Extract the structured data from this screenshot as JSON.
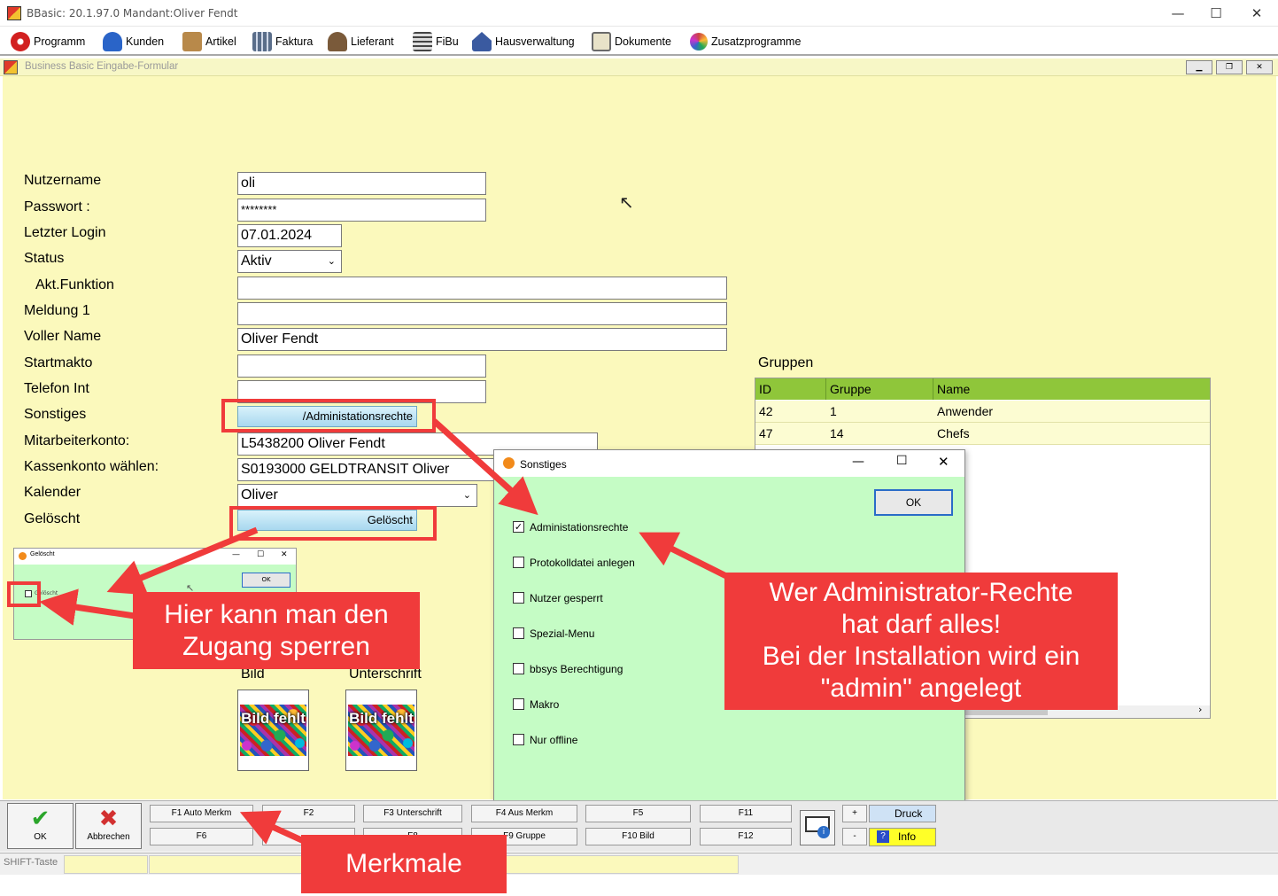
{
  "window": {
    "title": "BBasic: 20.1.97.0 Mandant:Oliver Fendt",
    "min": "—",
    "max": "☐",
    "close": "✕"
  },
  "menubar": {
    "items": [
      {
        "label": "Programm",
        "icon": "program-icon",
        "color": "#d22020"
      },
      {
        "label": "Kunden",
        "icon": "customer-icon",
        "color": "#2a64c8"
      },
      {
        "label": "Artikel",
        "icon": "article-icon",
        "color": "#b8894a"
      },
      {
        "label": "Faktura",
        "icon": "invoice-icon",
        "color": "#5a6e8a"
      },
      {
        "label": "Lieferant",
        "icon": "supplier-icon",
        "color": "#7a5a3a"
      },
      {
        "label": "FiBu",
        "icon": "accounting-icon",
        "color": "#444444"
      },
      {
        "label": "Hausverwaltung",
        "icon": "house-icon",
        "color": "#3a5aa0"
      },
      {
        "label": "Dokumente",
        "icon": "documents-icon",
        "color": "#6a6a6a"
      },
      {
        "label": "Zusatzprogramme",
        "icon": "addon-icon",
        "color": "#c44"
      }
    ]
  },
  "form": {
    "title": "Business Basic Eingabe-Formular",
    "labels": {
      "nutzername": "Nutzername",
      "passwort": "Passwort :",
      "letzter_login": "Letzter Login",
      "status": "Status",
      "akt_funktion": "Akt.Funktion",
      "meldung": "Meldung 1",
      "voller_name": "Voller Name",
      "startmakto": "Startmakto",
      "telefon": "Telefon Int",
      "sonstiges": "Sonstiges",
      "mitarbeiterkonto": "Mitarbeiterkonto:",
      "kassenkonto": "Kassenkonto wählen:",
      "kalender": "Kalender",
      "geloescht": "Gelöscht"
    },
    "values": {
      "nutzername": "oli",
      "passwort": "********",
      "letzter_login": "07.01.2024",
      "status": "Aktiv",
      "akt_funktion": "",
      "meldung": "",
      "voller_name": "Oliver Fendt",
      "startmakto": "",
      "telefon": "",
      "sonstiges": "/Administationsrechte",
      "mitarbeiterkonto": "L5438200 Oliver Fendt",
      "kassenkonto": "S0193000 GELDTRANSIT Oliver",
      "kalender": "Oliver",
      "geloescht": "Gelöscht"
    },
    "bild_label": "Bild",
    "unterschrift_label": "Unterschrift",
    "bild_placeholder": "Bild fehlt",
    "unterschrift_placeholder": "Bild fehlt"
  },
  "gruppen": {
    "title": "Gruppen",
    "columns": [
      "ID",
      "Gruppe",
      "Name"
    ],
    "rows": [
      {
        "id": "42",
        "gruppe": "1",
        "name": "Anwender"
      },
      {
        "id": "47",
        "gruppe": "14",
        "name": "Chefs"
      }
    ]
  },
  "dialog": {
    "title": "Sonstiges",
    "ok": "OK",
    "options": [
      {
        "label": "Administationsrechte",
        "checked": true
      },
      {
        "label": "Protokolldatei anlegen",
        "checked": false
      },
      {
        "label": "Nutzer gesperrt",
        "checked": false
      },
      {
        "label": "Spezial-Menu",
        "checked": false
      },
      {
        "label": "bbsys Berechtigung",
        "checked": false
      },
      {
        "label": "Makro",
        "checked": false
      },
      {
        "label": "Nur offline",
        "checked": false
      }
    ]
  },
  "small_dialog": {
    "title": "Gelöscht",
    "ok": "OK",
    "checkbox": "Gelöscht"
  },
  "annotations": {
    "sperren_line1": "Hier kann man den",
    "sperren_line2": "Zugang sperren",
    "admin_line1": "Wer Administrator-Rechte",
    "admin_line2": "hat darf alles!",
    "admin_line3": "Bei der Installation wird ein",
    "admin_line4": "\"admin\" angelegt",
    "merkmale": "Merkmale"
  },
  "bottom": {
    "ok": "OK",
    "abbrechen": "Abbrechen",
    "f1": "F1 Auto Merkm",
    "f2": "F2",
    "f3": "F3 Unterschrift",
    "f4": "F4 Aus Merkm",
    "f5": "F5",
    "f11": "F11",
    "f6": "F6",
    "f8": "F8",
    "f9": "F9 Gruppe",
    "f10": "F10 Bild",
    "f12": "F12",
    "plus": "+",
    "minus": "-",
    "druck": "Druck",
    "info": "Info"
  },
  "statusbar": {
    "shift": "SHIFT-Taste"
  },
  "colors": {
    "form_bg": "#fbf9bc",
    "dialog_bg": "#c5fcc5",
    "grid_header": "#8fc63a",
    "annotation": "#f03b3b"
  }
}
